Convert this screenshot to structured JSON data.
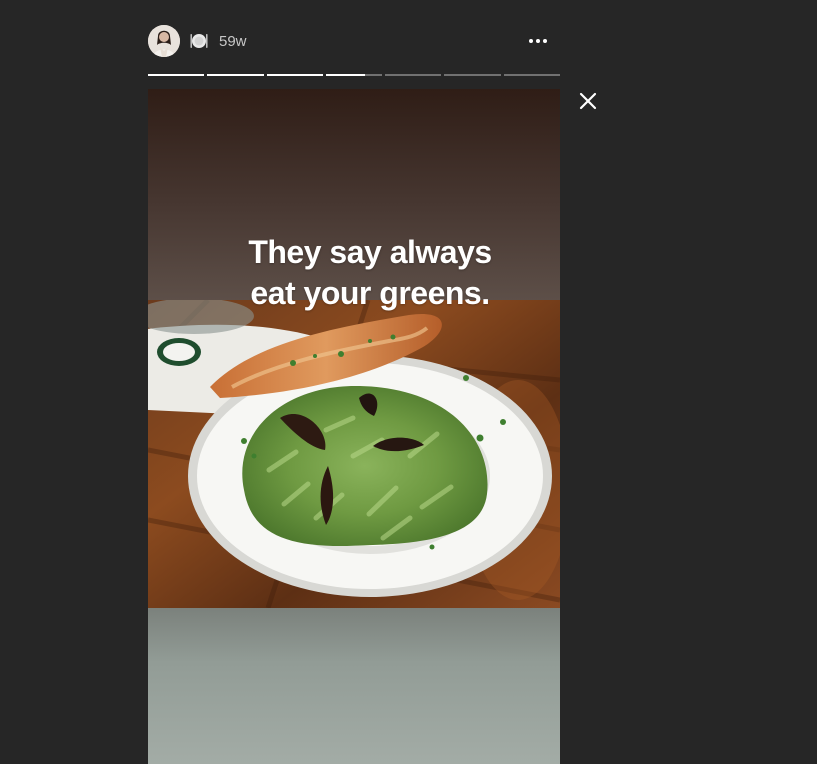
{
  "header": {
    "username_emoji": "🍽️",
    "timestamp": "59w",
    "more_label": "More options"
  },
  "story": {
    "caption_line1": "They say always",
    "caption_line2": "eat your greens.",
    "segments": [
      1,
      1,
      1,
      0.7,
      0,
      0,
      0
    ]
  },
  "colors": {
    "background": "#262626",
    "text_muted": "#c7c7c7",
    "progress_active": "#ffffff",
    "progress_inactive": "rgba(255,255,255,0.35)"
  },
  "icons": {
    "close": "close-icon",
    "more": "more-horizontal-icon",
    "avatar": "profile-avatar"
  }
}
